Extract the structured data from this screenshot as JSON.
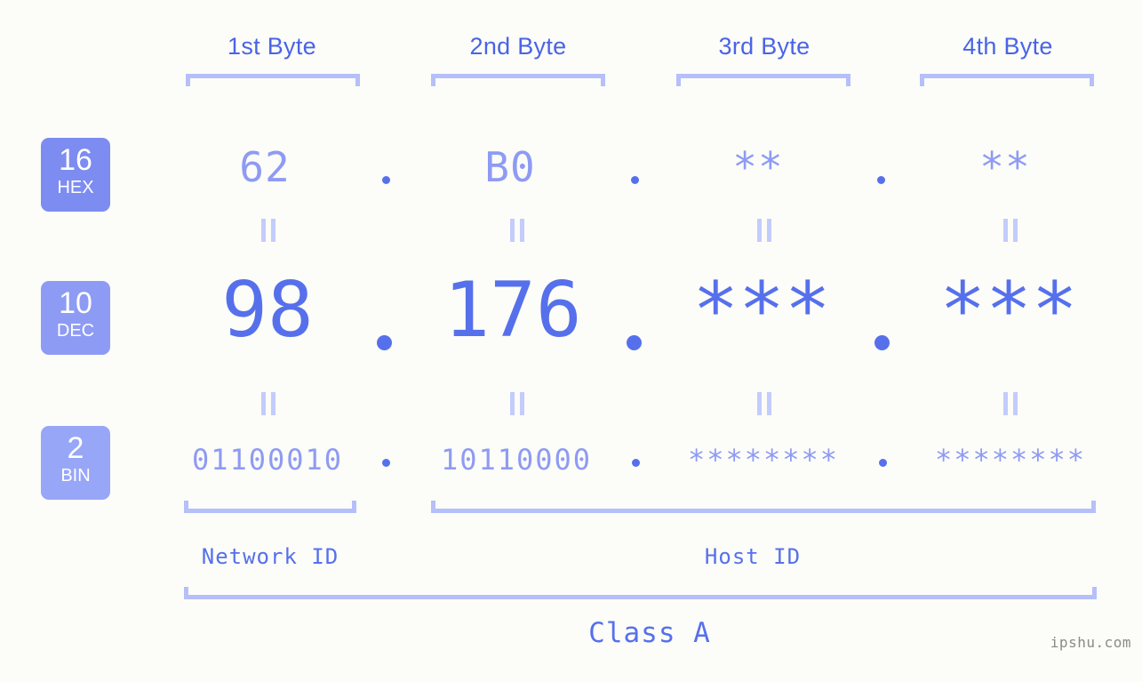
{
  "meta": {
    "background": "#fcfdf8",
    "accent_strong": "#5670ec",
    "accent_mid": "#8e9bf4",
    "accent_light": "#b5bffa",
    "watermark": "ipshu.com"
  },
  "headers": [
    {
      "label": "1st Byte"
    },
    {
      "label": "2nd Byte"
    },
    {
      "label": "3rd Byte"
    },
    {
      "label": "4th Byte"
    }
  ],
  "bases": [
    {
      "number": "16",
      "name": "HEX",
      "color": "#7d8cf0"
    },
    {
      "number": "10",
      "name": "DEC",
      "color": "#8e9bf4"
    },
    {
      "number": "2",
      "name": "BIN",
      "color": "#97a6f7"
    }
  ],
  "rows": {
    "hex": {
      "values": [
        "62",
        "B0",
        "**",
        "**"
      ],
      "separator": "."
    },
    "dec": {
      "values": [
        "98",
        "176",
        "***",
        "***"
      ],
      "separator": "."
    },
    "bin": {
      "values": [
        "01100010",
        "10110000",
        "********",
        "********"
      ],
      "separator": "."
    }
  },
  "equals_marks": {
    "glyph": "=",
    "count_per_row": 4
  },
  "sections": {
    "network_id": "Network ID",
    "host_id": "Host ID",
    "class": "Class A"
  }
}
